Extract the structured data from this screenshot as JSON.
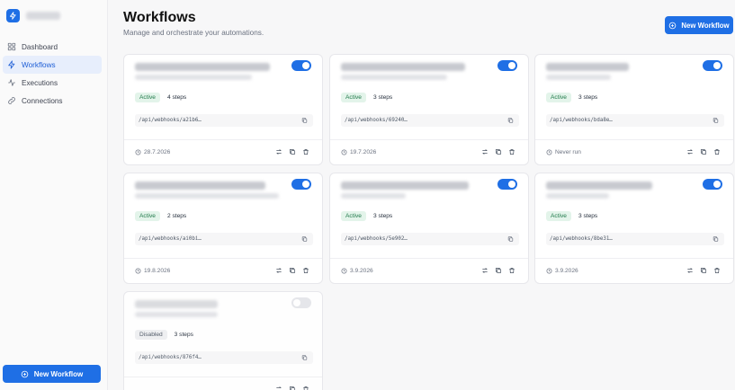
{
  "sidebar": {
    "items": [
      {
        "label": "Dashboard",
        "icon": "grid-icon"
      },
      {
        "label": "Workflows",
        "icon": "bolt-icon"
      },
      {
        "label": "Executions",
        "icon": "activity-icon"
      },
      {
        "label": "Connections",
        "icon": "link-icon"
      }
    ],
    "new_button": "New Workflow"
  },
  "header": {
    "title": "Workflows",
    "subtitle": "Manage and orchestrate your automations.",
    "new_button": "New Workflow"
  },
  "colors": {
    "accent": "#1f6fe5",
    "active_badge_bg": "#e3f4ea",
    "active_badge_text": "#217a4b"
  },
  "cards": [
    {
      "status": "Active",
      "steps": "4 steps",
      "url": "/api/webhooks/a21b6…",
      "date": "28.7.2026",
      "enabled": true
    },
    {
      "status": "Active",
      "steps": "3 steps",
      "url": "/api/webhooks/69240…",
      "date": "19.7.2026",
      "enabled": true
    },
    {
      "status": "Active",
      "steps": "3 steps",
      "url": "/api/webhooks/bda8e…",
      "date": "Never run",
      "enabled": true
    },
    {
      "status": "Active",
      "steps": "2 steps",
      "url": "/api/webhooks/ai0bi…",
      "date": "19.8.2026",
      "enabled": true
    },
    {
      "status": "Active",
      "steps": "3 steps",
      "url": "/api/webhooks/5e902…",
      "date": "3.9.2026",
      "enabled": true
    },
    {
      "status": "Active",
      "steps": "3 steps",
      "url": "/api/webhooks/8be31…",
      "date": "3.9.2026",
      "enabled": true
    },
    {
      "status": "Disabled",
      "steps": "3 steps",
      "url": "/api/webhooks/876f4…",
      "date": "",
      "enabled": false
    }
  ]
}
